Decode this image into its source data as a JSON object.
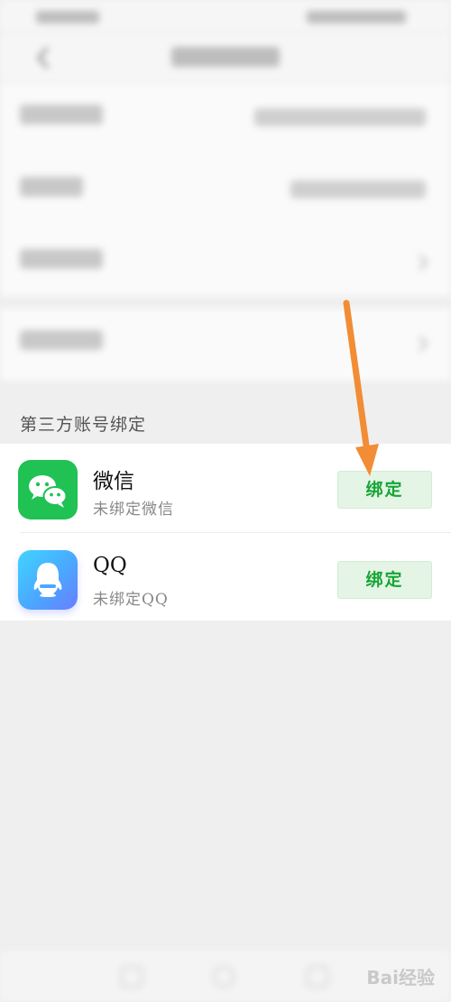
{
  "third_party": {
    "section_title": "第三方账号绑定",
    "items": [
      {
        "name": "微信",
        "status": "未绑定微信",
        "button_label": "绑定",
        "icon": "wechat-icon"
      },
      {
        "name": "QQ",
        "status": "未绑定QQ",
        "button_label": "绑定",
        "icon": "qq-icon"
      }
    ]
  },
  "watermark": "Bai经验",
  "colors": {
    "wechat_green": "#1fc253",
    "bind_button_bg": "#e4f5e6",
    "bind_button_text": "#17a536",
    "annotation_arrow": "#f28c35",
    "page_background": "#efefef"
  }
}
